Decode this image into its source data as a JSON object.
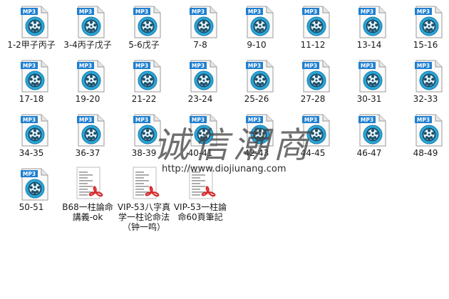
{
  "files": [
    {
      "label": "1-2甲子丙子",
      "type": "mp3",
      "badge": "MP3"
    },
    {
      "label": "3-4丙子戊子",
      "type": "mp3",
      "badge": "MP3"
    },
    {
      "label": "5-6戊子",
      "type": "mp3",
      "badge": "MP3"
    },
    {
      "label": "7-8",
      "type": "mp3",
      "badge": "MP3"
    },
    {
      "label": "9-10",
      "type": "mp3",
      "badge": "MP3"
    },
    {
      "label": "11-12",
      "type": "mp3",
      "badge": "MP3"
    },
    {
      "label": "13-14",
      "type": "mp3",
      "badge": "MP3"
    },
    {
      "label": "15-16",
      "type": "mp3",
      "badge": "MP3"
    },
    {
      "label": "17-18",
      "type": "mp3",
      "badge": "MP3"
    },
    {
      "label": "19-20",
      "type": "mp3",
      "badge": "MP3"
    },
    {
      "label": "21-22",
      "type": "mp3",
      "badge": "MP3"
    },
    {
      "label": "23-24",
      "type": "mp3",
      "badge": "MP3"
    },
    {
      "label": "25-26",
      "type": "mp3",
      "badge": "MP3"
    },
    {
      "label": "27-28",
      "type": "mp3",
      "badge": "MP3"
    },
    {
      "label": "30-31",
      "type": "mp3",
      "badge": "MP3"
    },
    {
      "label": "32-33",
      "type": "mp3",
      "badge": "MP3"
    },
    {
      "label": "34-35",
      "type": "mp3",
      "badge": "MP3"
    },
    {
      "label": "36-37",
      "type": "mp3",
      "badge": "MP3"
    },
    {
      "label": "38-39",
      "type": "mp3",
      "badge": "MP3"
    },
    {
      "label": "40-41",
      "type": "mp3",
      "badge": "MP3"
    },
    {
      "label": "42-43",
      "type": "mp3",
      "badge": "MP3"
    },
    {
      "label": "44-45",
      "type": "mp3",
      "badge": "MP3"
    },
    {
      "label": "46-47",
      "type": "mp3",
      "badge": "MP3"
    },
    {
      "label": "48-49",
      "type": "mp3",
      "badge": "MP3"
    },
    {
      "label": "50-51",
      "type": "mp3",
      "badge": "MP3"
    },
    {
      "label": "B68一柱論命講義-ok",
      "type": "pdf"
    },
    {
      "label": "VIP-53八字真学一柱论命法（钟一鸣）",
      "type": "pdf"
    },
    {
      "label": "VIP-53一柱論命60頁筆記",
      "type": "pdf"
    }
  ],
  "watermark": {
    "chars": "诚信潮商",
    "url": "http://www.diojiunang.com"
  },
  "colors": {
    "mp3_badge": "#1f7fd0",
    "mp3_disc": "#2aa6d8",
    "pdf_red": "#d62b2b"
  }
}
